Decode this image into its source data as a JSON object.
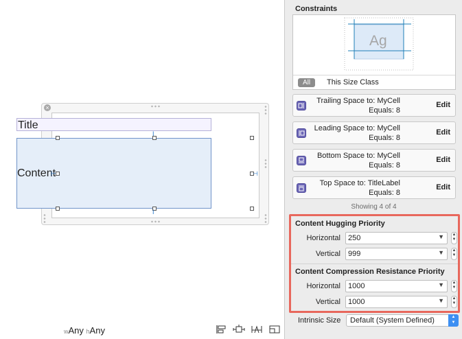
{
  "canvas": {
    "title_label": "Title",
    "content_label": "Content",
    "size_class": {
      "w_prefix": "w",
      "w_value": "Any",
      "h_prefix": "h",
      "h_value": "Any"
    },
    "tools": [
      "align-icon",
      "pin-icon",
      "resolve-issues-icon",
      "resizing-behavior-icon"
    ]
  },
  "inspector": {
    "constraints_title": "Constraints",
    "preview": {
      "sample_text": "Ag",
      "all_label": "All",
      "size_class_label": "This Size Class"
    },
    "constraints": [
      {
        "icon": "trailing-space-icon",
        "line1": "Trailing Space to:  MyCell",
        "line2": "Equals:  8",
        "edit": "Edit"
      },
      {
        "icon": "leading-space-icon",
        "line1": "Leading Space to:  MyCell",
        "line2": "Equals:  8",
        "edit": "Edit"
      },
      {
        "icon": "bottom-space-icon",
        "line1": "Bottom Space to:  MyCell",
        "line2": "Equals:  8",
        "edit": "Edit"
      },
      {
        "icon": "top-space-icon",
        "line1": "Top Space to:  TitleLabel",
        "line2": "Equals:  8",
        "edit": "Edit"
      }
    ],
    "showing": "Showing 4 of 4",
    "hugging": {
      "title": "Content Hugging Priority",
      "horizontal_label": "Horizontal",
      "horizontal_value": "250",
      "vertical_label": "Vertical",
      "vertical_value": "999"
    },
    "compression": {
      "title": "Content Compression Resistance Priority",
      "horizontal_label": "Horizontal",
      "horizontal_value": "1000",
      "vertical_label": "Vertical",
      "vertical_value": "1000"
    },
    "intrinsic": {
      "label": "Intrinsic Size",
      "value": "Default (System Defined)"
    },
    "highlight_color": "#e8675c"
  }
}
